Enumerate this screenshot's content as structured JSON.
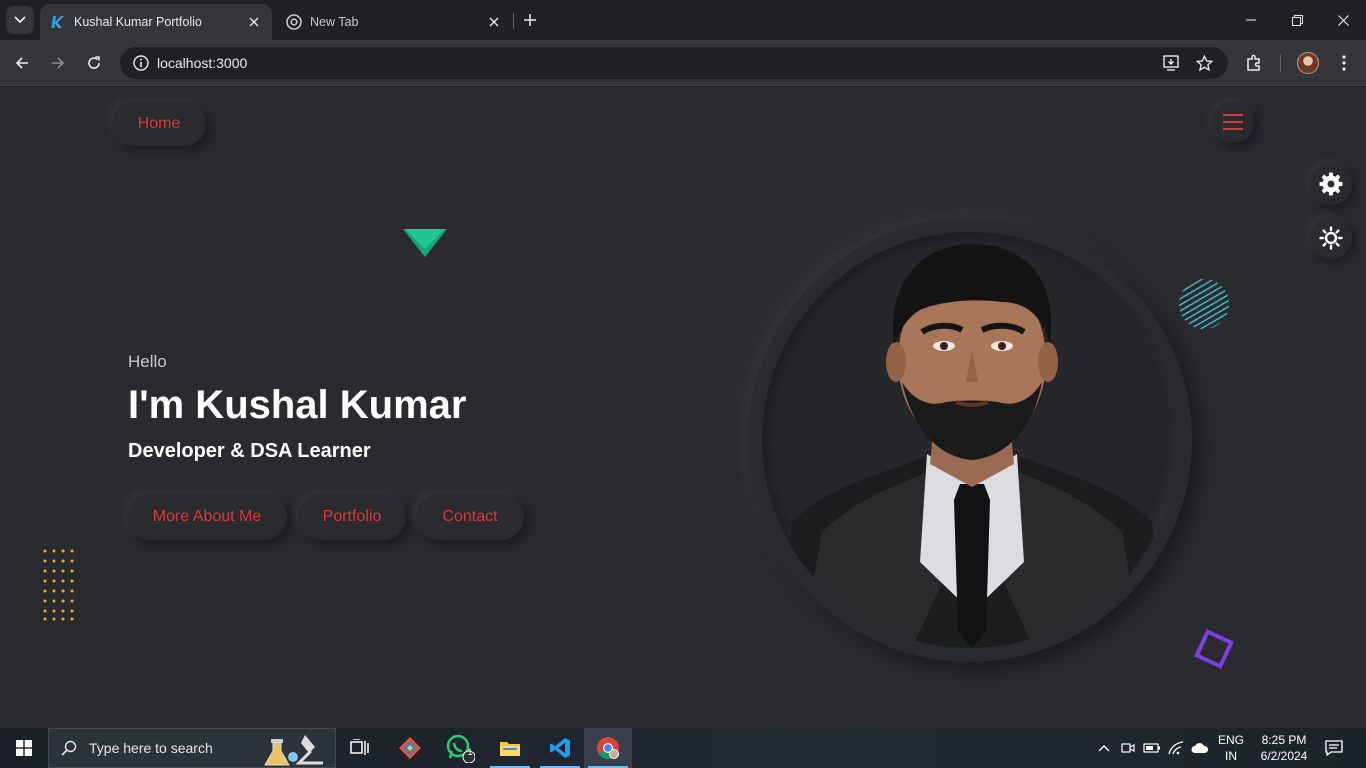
{
  "browser": {
    "tabs": [
      {
        "title": "Kushal Kumar Portfolio",
        "favicon": "k-logo-icon",
        "active": true
      },
      {
        "title": "New Tab",
        "favicon": "chrome-icon",
        "active": false
      }
    ],
    "url": "localhost:3000"
  },
  "nav": {
    "home_label": "Home"
  },
  "hero": {
    "greeting": "Hello",
    "name": "I'm Kushal Kumar",
    "role": "Developer & DSA Learner",
    "buttons": {
      "about": "More About Me",
      "portfolio": "Portfolio",
      "contact": "Contact"
    }
  },
  "colors": {
    "accent": "#d83a3a",
    "background": "#2a2b2f",
    "triangle": "#1ec794",
    "dots": "#f5a623",
    "stripes": "#3fb6c7",
    "square": "#7b3fe4"
  },
  "taskbar": {
    "search_placeholder": "Type here to search",
    "whatsapp_badge": "1",
    "language": [
      "ENG",
      "IN"
    ],
    "time": "8:25 PM",
    "date": "6/2/2024"
  }
}
